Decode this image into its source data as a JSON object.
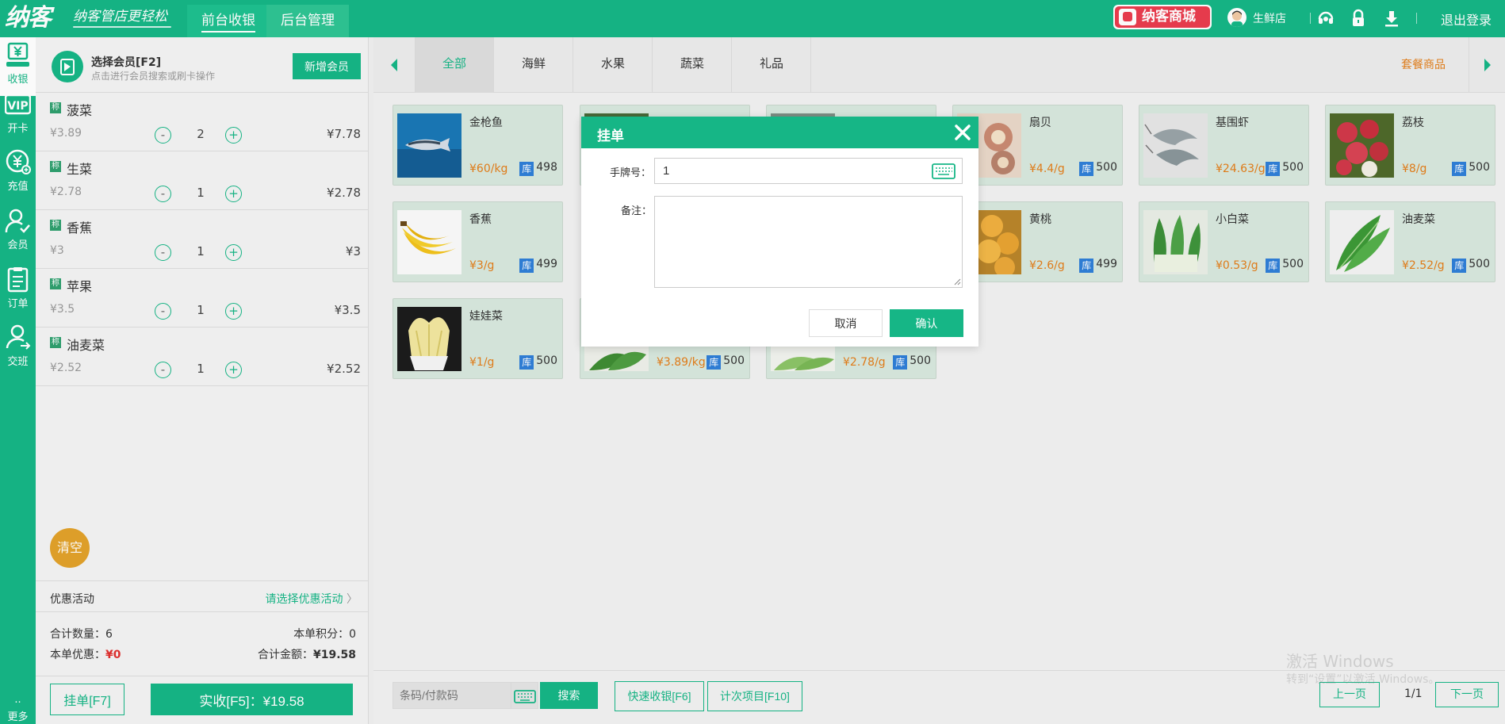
{
  "header": {
    "logo": "纳客",
    "slogan": "纳客管店更轻松",
    "nav": [
      "前台收银",
      "后台管理"
    ],
    "mall": "纳客商城",
    "user": "生鲜店",
    "logout": "退出登录"
  },
  "rail": {
    "items": [
      {
        "label": "收银",
        "icon": "cash-register-icon"
      },
      {
        "label": "开卡",
        "icon": "vip-card-icon"
      },
      {
        "label": "充值",
        "icon": "recharge-icon"
      },
      {
        "label": "会员",
        "icon": "member-icon"
      },
      {
        "label": "订单",
        "icon": "order-icon"
      },
      {
        "label": "交班",
        "icon": "shift-handover-icon"
      }
    ],
    "more": "更多"
  },
  "member": {
    "title": "选择会员[F2]",
    "subtitle": "点击进行会员搜索或刷卡操作",
    "new_button": "新增会员"
  },
  "cart": {
    "tag": "称",
    "items": [
      {
        "name": "菠菜",
        "price": "¥3.89",
        "qty": "2",
        "total": "¥7.78"
      },
      {
        "name": "生菜",
        "price": "¥2.78",
        "qty": "1",
        "total": "¥2.78"
      },
      {
        "name": "香蕉",
        "price": "¥3",
        "qty": "1",
        "total": "¥3"
      },
      {
        "name": "苹果",
        "price": "¥3.5",
        "qty": "1",
        "total": "¥3.5"
      },
      {
        "name": "油麦菜",
        "price": "¥2.52",
        "qty": "1",
        "total": "¥2.52"
      }
    ],
    "clear": "清空",
    "promo_label": "优惠活动",
    "promo_link": "请选择优惠活动",
    "count_label": "合计数量：",
    "count": "6",
    "points_label": "本单积分：",
    "points": "0",
    "discount_label": "本单优惠：",
    "discount": "¥0",
    "amount_label": "合计金额：",
    "amount": "¥19.58",
    "hold_button": "挂单[F7]",
    "pay_button": "实收[F5]：¥19.58"
  },
  "categories": [
    "全部",
    "海鲜",
    "水果",
    "蔬菜",
    "礼品"
  ],
  "combo_link": "套餐商品",
  "stock_tag": "库",
  "products": [
    {
      "name": "金枪鱼",
      "price": "¥60/kg",
      "stock": "498"
    },
    {
      "name": "",
      "price": "",
      "stock": ""
    },
    {
      "name": "",
      "price": "",
      "stock": ""
    },
    {
      "name": "扇贝",
      "price": "¥4.4/g",
      "stock": "500"
    },
    {
      "name": "基围虾",
      "price": "¥24.63/g",
      "stock": "500"
    },
    {
      "name": "荔枝",
      "price": "¥8/g",
      "stock": "500"
    },
    {
      "name": "香蕉",
      "price": "¥3/g",
      "stock": "499"
    },
    {
      "name": "",
      "price": "",
      "stock": ""
    },
    {
      "name": "",
      "price": "",
      "stock": ""
    },
    {
      "name": "黄桃",
      "price": "¥2.6/g",
      "stock": "499"
    },
    {
      "name": "小白菜",
      "price": "¥0.53/g",
      "stock": "500"
    },
    {
      "name": "油麦菜",
      "price": "¥2.52/g",
      "stock": "500"
    },
    {
      "name": "娃娃菜",
      "price": "¥1/g",
      "stock": "500"
    },
    {
      "name": "",
      "price": "¥3.89/kg",
      "stock": "500"
    },
    {
      "name": "",
      "price": "¥2.78/g",
      "stock": "500"
    }
  ],
  "bottom": {
    "barcode_placeholder": "条码/付款码",
    "search": "搜索",
    "quick_pay": "快速收银[F6]",
    "count_item": "计次项目[F10]",
    "prev": "上一页",
    "page": "1/1",
    "next": "下一页",
    "watermark": "激活 Windows",
    "watermark_sub": "转到“设置”以激活 Windows。"
  },
  "modal": {
    "title": "挂单",
    "tag_label": "手牌号：",
    "tag_value": "1",
    "note_label": "备注：",
    "note_value": "",
    "cancel": "取消",
    "confirm": "确认"
  },
  "colors": {
    "brand": "#16b686",
    "price": "#e37e1a",
    "danger": "#e0302e",
    "stock_tag": "#2f7fd8",
    "clear": "#e2a22a"
  }
}
